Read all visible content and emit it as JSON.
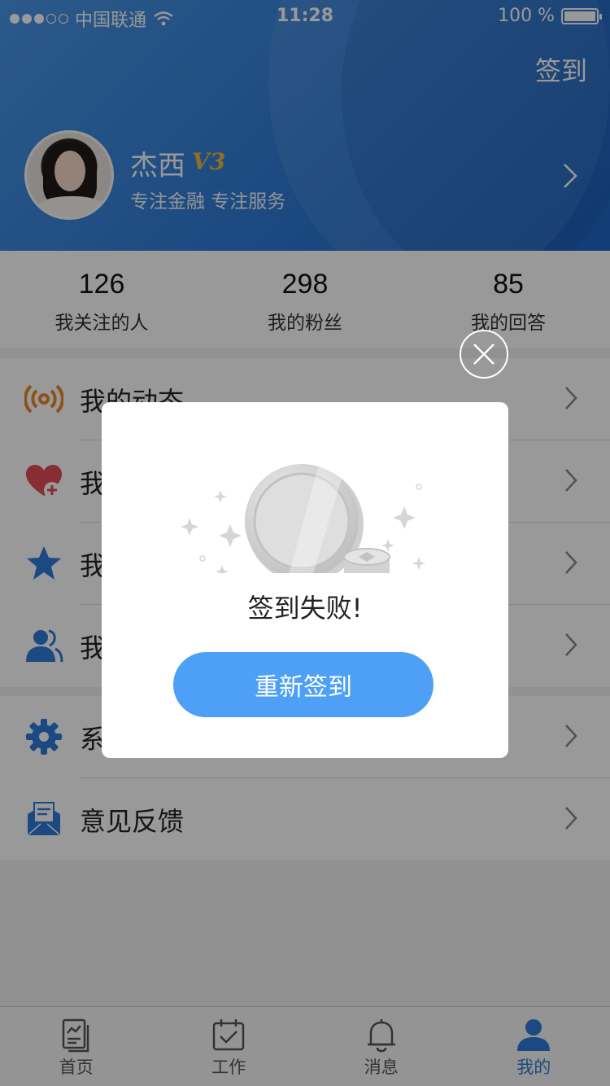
{
  "status_bar": {
    "carrier": "中国联通",
    "time": "11:28",
    "battery": "100 %"
  },
  "header": {
    "signin_label": "签到",
    "user": {
      "name": "杰西",
      "vip_badge": "V3",
      "slogan": "专注金融 专注服务"
    }
  },
  "stats": [
    {
      "value": "126",
      "label": "我关注的人"
    },
    {
      "value": "298",
      "label": "我的粉丝"
    },
    {
      "value": "85",
      "label": "我的回答"
    }
  ],
  "menu_group1": [
    {
      "label": "我的动态",
      "icon": "broadcast-icon",
      "color": "#e8892a"
    },
    {
      "label": "我",
      "icon": "heart-plus-icon",
      "color": "#e24b56"
    },
    {
      "label": "我",
      "icon": "star-icon",
      "color": "#2d7bd8"
    },
    {
      "label": "我",
      "icon": "users-icon",
      "color": "#2d7bd8"
    }
  ],
  "menu_group2": [
    {
      "label": "系",
      "icon": "gear-icon",
      "color": "#2d7bd8"
    },
    {
      "label": "意见反馈",
      "icon": "mail-feedback-icon",
      "color": "#2d7bd8"
    }
  ],
  "tabs": [
    {
      "label": "首页",
      "icon": "home-doc-icon",
      "active": false
    },
    {
      "label": "工作",
      "icon": "calendar-check-icon",
      "active": false
    },
    {
      "label": "消息",
      "icon": "bell-icon",
      "active": false
    },
    {
      "label": "我的",
      "icon": "person-icon",
      "active": true
    }
  ],
  "dialog": {
    "message": "签到失败!",
    "retry_label": "重新签到"
  },
  "colors": {
    "accent": "#2d7bd8",
    "button": "#4ea0f7",
    "vip": "#f0b73a"
  }
}
